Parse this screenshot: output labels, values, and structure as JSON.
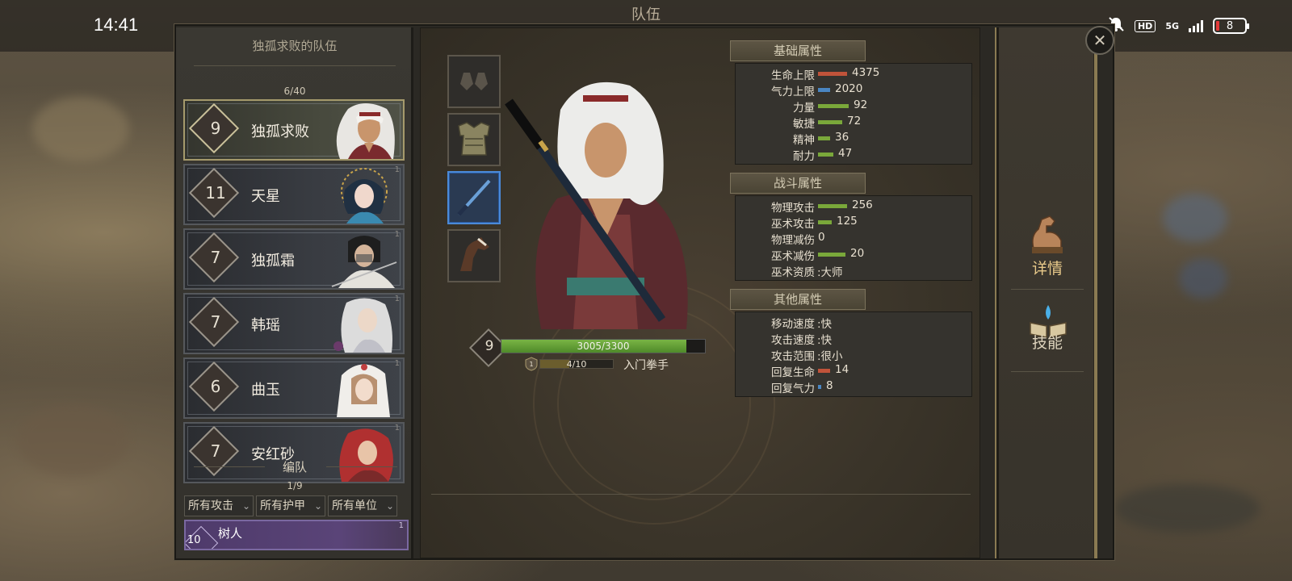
{
  "status_bar": {
    "time": "14:41",
    "hd_label": "HD",
    "network": "5G",
    "battery": "8"
  },
  "screen": {
    "title": "队伍"
  },
  "team": {
    "title": "独孤求败的队伍",
    "count": "6/40",
    "heroes": [
      {
        "level": "9",
        "name": "独孤求败",
        "corner": ""
      },
      {
        "level": "11",
        "name": "天星",
        "corner": "1"
      },
      {
        "level": "7",
        "name": "独孤霜",
        "corner": "1"
      },
      {
        "level": "7",
        "name": "韩瑶",
        "corner": "1"
      },
      {
        "level": "6",
        "name": "曲玉",
        "corner": "1"
      },
      {
        "level": "7",
        "name": "安红砂",
        "corner": "1"
      }
    ]
  },
  "formation": {
    "label": "编队",
    "count": "1/9",
    "filters": [
      "所有攻击",
      "所有护甲",
      "所有单位"
    ],
    "unit": {
      "level": "10",
      "name": "树人",
      "corner": "1"
    }
  },
  "hero_detail": {
    "level": "9",
    "hp_text": "3005/3300",
    "hp_fraction": 0.91,
    "xp_text": "4/10",
    "xp_fraction": 0.4,
    "rank_title": "入门拳手"
  },
  "attributes": {
    "basic": {
      "header": "基础属性",
      "rows": [
        {
          "label": "生命上限",
          "value": "4375",
          "bar_fraction": 0.95,
          "bar_color": "#c0533a"
        },
        {
          "label": "气力上限",
          "value": "2020",
          "bar_fraction": 0.4,
          "bar_color": "#4a86c2"
        },
        {
          "label": "力量",
          "value": "92",
          "bar_fraction": 1.0,
          "bar_color": "#7aa83a"
        },
        {
          "label": "敏捷",
          "value": "72",
          "bar_fraction": 0.78,
          "bar_color": "#7aa83a"
        },
        {
          "label": "精神",
          "value": "36",
          "bar_fraction": 0.4,
          "bar_color": "#7aa83a"
        },
        {
          "label": "耐力",
          "value": "47",
          "bar_fraction": 0.5,
          "bar_color": "#7aa83a"
        }
      ]
    },
    "combat": {
      "header": "战斗属性",
      "rows": [
        {
          "label": "物理攻击",
          "value": "256",
          "bar_fraction": 0.95,
          "bar_color": "#7aa83a"
        },
        {
          "label": "巫术攻击",
          "value": "125",
          "bar_fraction": 0.45,
          "bar_color": "#7aa83a"
        },
        {
          "label": "物理减伤",
          "value": "0",
          "bar_fraction": 0,
          "bar_color": "#7aa83a"
        },
        {
          "label": "巫术减伤",
          "value": "20",
          "bar_fraction": 0.9,
          "bar_color": "#7aa83a"
        },
        {
          "label": "巫术资质",
          "value": ":大师",
          "bar_fraction": 0,
          "bar_color": ""
        }
      ]
    },
    "other": {
      "header": "其他属性",
      "rows": [
        {
          "label": "移动速度",
          "value": ":快",
          "bar_fraction": 0,
          "bar_color": ""
        },
        {
          "label": "攻击速度",
          "value": ":快",
          "bar_fraction": 0,
          "bar_color": ""
        },
        {
          "label": "攻击范围",
          "value": ":很小",
          "bar_fraction": 0,
          "bar_color": ""
        },
        {
          "label": "回复生命",
          "value": "14",
          "bar_fraction": 0.4,
          "bar_color": "#c0533a"
        },
        {
          "label": "回复气力",
          "value": "8",
          "bar_fraction": 0.1,
          "bar_color": "#4a86c2"
        }
      ]
    }
  },
  "tabs": [
    {
      "label": "详情",
      "icon": "strength-arm-icon",
      "active": true
    },
    {
      "label": "技能",
      "icon": "skill-book-icon",
      "active": false
    }
  ],
  "close_label": "✕"
}
